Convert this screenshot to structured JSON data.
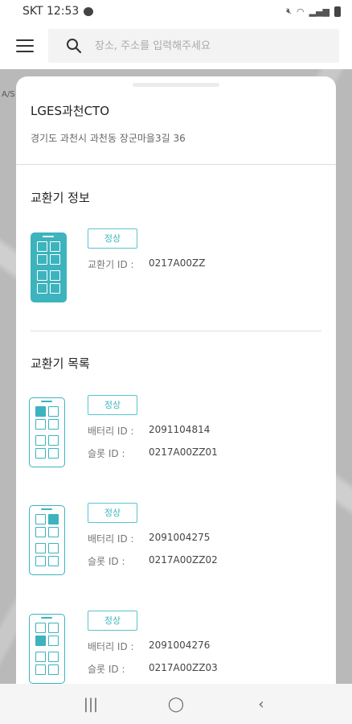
{
  "status_bar": {
    "carrier_time": "SKT 12:53",
    "icons": [
      "message-icon",
      "mute-icon",
      "wifi-icon",
      "signal-icon",
      "battery-icon"
    ]
  },
  "search": {
    "placeholder": "장소, 주소를 입력해주세요"
  },
  "map": {
    "labels": [
      "A/S"
    ]
  },
  "station": {
    "name": "LGES과천CTO",
    "address": "경기도 과천시 과천동 장군마을3길 36"
  },
  "exchanger_info": {
    "section_title": "교환기 정보",
    "status": "정상",
    "id_label": "교환기 ID :",
    "id_value": "0217A00ZZ"
  },
  "exchanger_list": {
    "section_title": "교환기 목록",
    "items": [
      {
        "status": "정상",
        "battery_label": "배터리 ID :",
        "battery_id": "2091104814",
        "slot_label": "슬롯 ID :",
        "slot_id": "0217A00ZZ01"
      },
      {
        "status": "정상",
        "battery_label": "배터리 ID :",
        "battery_id": "2091004275",
        "slot_label": "슬롯 ID :",
        "slot_id": "0217A00ZZ02"
      },
      {
        "status": "정상",
        "battery_label": "배터리 ID :",
        "battery_id": "2091004276",
        "slot_label": "슬롯 ID :",
        "slot_id": "0217A00ZZ03"
      }
    ]
  },
  "colors": {
    "accent": "#3db3be"
  }
}
